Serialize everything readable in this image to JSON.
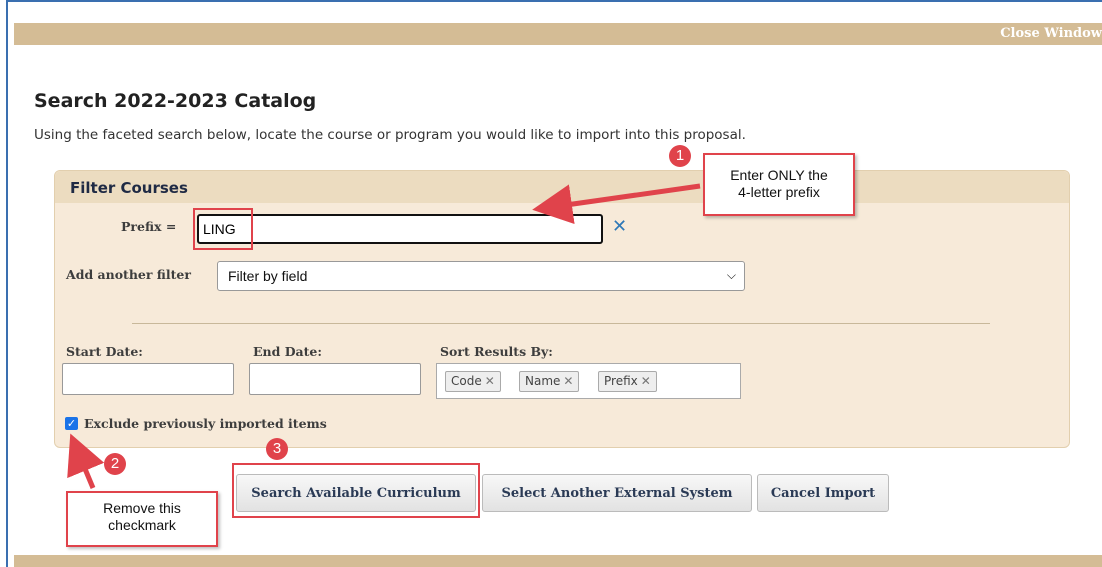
{
  "window": {
    "close_label": "Close Window"
  },
  "page": {
    "title": "Search 2022-2023 Catalog",
    "intro": "Using the faceted search below, locate the course or program you would like to import into this proposal."
  },
  "filter": {
    "title": "Filter Courses",
    "prefix_label": "Prefix =",
    "prefix_value": "LING",
    "clear_icon": "close-x-icon",
    "add_filter_label": "Add another filter",
    "add_filter_selected": "Filter by field",
    "start_date_label": "Start Date:",
    "end_date_label": "End Date:",
    "sort_label": "Sort Results By:",
    "sort_chips": [
      "Code",
      "Name",
      "Prefix"
    ],
    "exclude_label": "Exclude previously imported items",
    "exclude_checked": true
  },
  "buttons": {
    "search": "Search Available Curriculum",
    "select_other": "Select Another External System",
    "cancel": "Cancel Import"
  },
  "annotations": {
    "badge1": "1",
    "badge2": "2",
    "badge3": "3",
    "callout1_line1": "Enter ONLY the",
    "callout1_line2": "4-letter prefix",
    "callout2_line1": "Remove this",
    "callout2_line2": "checkmark"
  },
  "colors": {
    "accent_bar": "#d4bc95",
    "panel": "#f7ead9",
    "highlight": "#e0434b",
    "clear_icon": "#2e78b7",
    "checkbox": "#1a73e8"
  }
}
